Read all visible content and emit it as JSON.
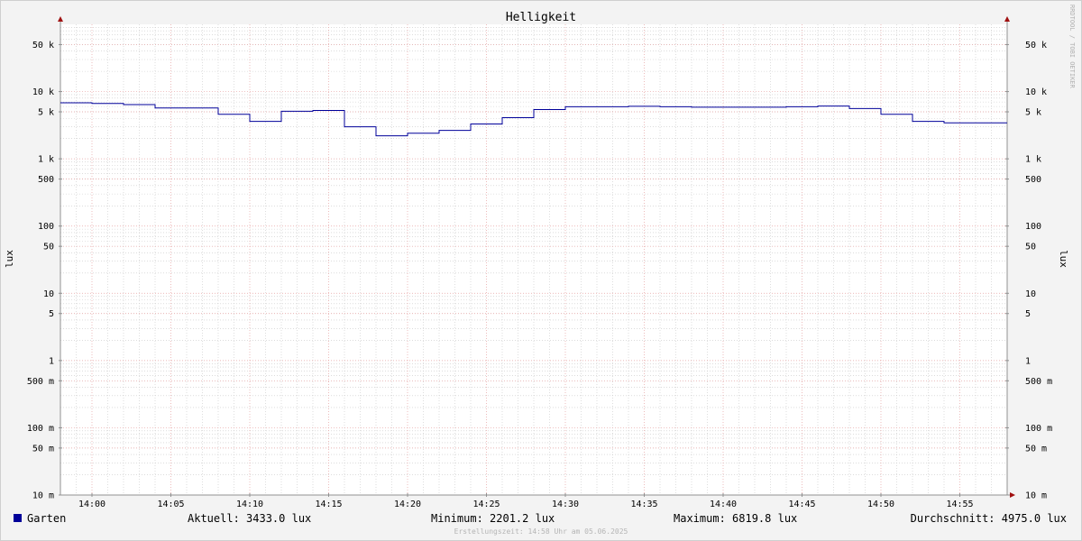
{
  "chart_data": {
    "type": "line",
    "title": "Helligkeit",
    "ylabel_left": "lux",
    "ylabel_right": "lux",
    "y_scale": "log",
    "ylim": [
      0.01,
      100000
    ],
    "xlim": [
      "13:58",
      "14:58"
    ],
    "y_major_ticks": [
      {
        "value": 50000,
        "label": "50 k"
      },
      {
        "value": 10000,
        "label": "10 k"
      },
      {
        "value": 5000,
        "label": "5 k"
      },
      {
        "value": 1000,
        "label": "1 k"
      },
      {
        "value": 500,
        "label": "500"
      },
      {
        "value": 100,
        "label": "100"
      },
      {
        "value": 50,
        "label": "50"
      },
      {
        "value": 10,
        "label": "10"
      },
      {
        "value": 5,
        "label": "5"
      },
      {
        "value": 1,
        "label": "1"
      },
      {
        "value": 0.5,
        "label": "500 m"
      },
      {
        "value": 0.1,
        "label": "100 m"
      },
      {
        "value": 0.05,
        "label": "50 m"
      },
      {
        "value": 0.01,
        "label": "10 m"
      }
    ],
    "x_ticks": [
      "14:00",
      "14:05",
      "14:10",
      "14:15",
      "14:20",
      "14:25",
      "14:30",
      "14:35",
      "14:40",
      "14:45",
      "14:50",
      "14:55"
    ],
    "grid": true,
    "series": [
      {
        "name": "Garten",
        "color": "#000099",
        "step": true,
        "points": [
          {
            "x": "13:58",
            "y": 6819.8
          },
          {
            "x": "14:00",
            "y": 6650
          },
          {
            "x": "14:02",
            "y": 6400
          },
          {
            "x": "14:04",
            "y": 5700
          },
          {
            "x": "14:08",
            "y": 4600
          },
          {
            "x": "14:10",
            "y": 3600
          },
          {
            "x": "14:12",
            "y": 5100
          },
          {
            "x": "14:14",
            "y": 5250
          },
          {
            "x": "14:16",
            "y": 3000
          },
          {
            "x": "14:18",
            "y": 2201.2
          },
          {
            "x": "14:20",
            "y": 2400
          },
          {
            "x": "14:22",
            "y": 2650
          },
          {
            "x": "14:24",
            "y": 3300
          },
          {
            "x": "14:26",
            "y": 4100
          },
          {
            "x": "14:28",
            "y": 5400
          },
          {
            "x": "14:30",
            "y": 5950
          },
          {
            "x": "14:34",
            "y": 6050
          },
          {
            "x": "14:36",
            "y": 5950
          },
          {
            "x": "14:38",
            "y": 5850
          },
          {
            "x": "14:44",
            "y": 5950
          },
          {
            "x": "14:46",
            "y": 6100
          },
          {
            "x": "14:48",
            "y": 5600
          },
          {
            "x": "14:50",
            "y": 4600
          },
          {
            "x": "14:52",
            "y": 3600
          },
          {
            "x": "14:54",
            "y": 3433.0
          },
          {
            "x": "14:58",
            "y": 3433.0
          }
        ]
      }
    ],
    "legend": {
      "label": "Garten",
      "color": "#000099",
      "current": "Aktuell: 3433.0 lux",
      "minimum": "Minimum: 2201.2 lux",
      "maximum": "Maximum: 6819.8 lux",
      "average": "Durchschnitt: 4975.0 lux"
    },
    "watermark": "RRDTOOL / TOBI OETIKER",
    "footer": "Erstellungszeit: 14:58 Uhr am 05.06.2025",
    "colors": {
      "background": "#f3f3f3",
      "canvas": "#ffffff",
      "major_grid": "#e6a0a0",
      "minor_grid": "#c8c8c8",
      "axis": "#909090",
      "arrow": "#a01010"
    }
  }
}
